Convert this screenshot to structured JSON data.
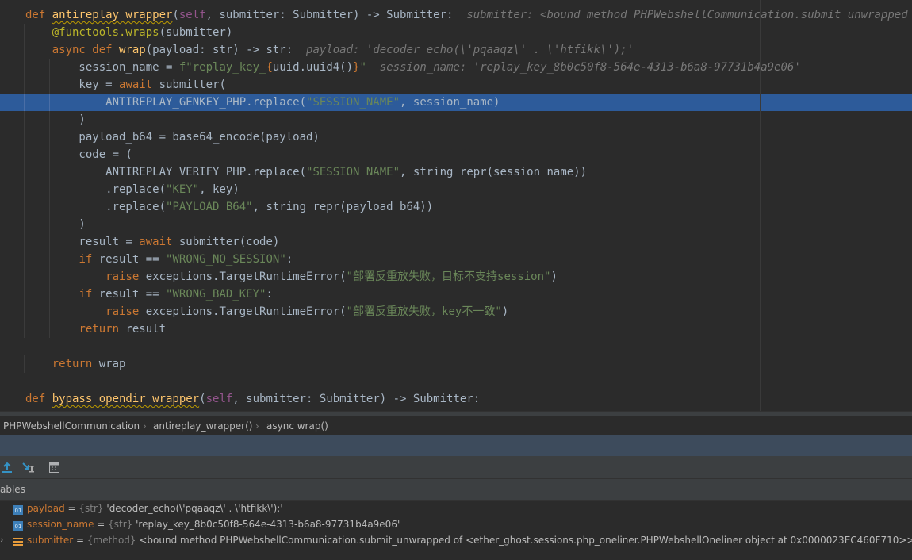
{
  "editor": {
    "lines": [
      {
        "t": [
          [
            "def ",
            "kw"
          ],
          [
            "antireplay_wrapper",
            "fn squig"
          ],
          [
            "(",
            ""
          ],
          [
            "self",
            "self"
          ],
          [
            ", submitter: Submitter) -> Submitter:",
            ""
          ],
          [
            "  submitter: <bound method PHPWebshellCommunication.submit_unwrapped of <eth",
            "hint"
          ]
        ]
      },
      {
        "t": [
          [
            "    ",
            ""
          ],
          [
            "@functools.wraps",
            "dec"
          ],
          [
            "(submitter)",
            ""
          ]
        ]
      },
      {
        "t": [
          [
            "    ",
            ""
          ],
          [
            "async def ",
            "kw"
          ],
          [
            "wrap",
            "fn"
          ],
          [
            "(payload: str) -> str:",
            ""
          ],
          [
            "  payload: 'decoder_echo(\\'pqaaqz\\' . \\'htfikk\\');'",
            "hint"
          ]
        ]
      },
      {
        "t": [
          [
            "        session_name = ",
            ""
          ],
          [
            "f\"replay_key_",
            "str"
          ],
          [
            "{",
            "brace"
          ],
          [
            "uuid.uuid4()",
            ""
          ],
          [
            "}",
            "brace"
          ],
          [
            "\"",
            "str"
          ],
          [
            "  session_name: 'replay_key_8b0c50f8-564e-4313-b6a8-97731b4a9e06'",
            "hint"
          ]
        ]
      },
      {
        "t": [
          [
            "        key = ",
            ""
          ],
          [
            "await ",
            "kw"
          ],
          [
            "submitter(",
            ""
          ]
        ]
      },
      {
        "t": [
          [
            "            ANTIREPLAY_GENKEY_PHP.replace(",
            ""
          ],
          [
            "\"SESSION_NAME\"",
            "str"
          ],
          [
            ", session_name)",
            ""
          ]
        ],
        "hl": true
      },
      {
        "t": [
          [
            "        )",
            ""
          ]
        ]
      },
      {
        "t": [
          [
            "        payload_b64 = base64_encode(payload)",
            ""
          ]
        ]
      },
      {
        "t": [
          [
            "        code = (",
            ""
          ]
        ]
      },
      {
        "t": [
          [
            "            ANTIREPLAY_VERIFY_PHP.replace(",
            ""
          ],
          [
            "\"SESSION_NAME\"",
            "str"
          ],
          [
            ", string_repr(session_name))",
            ""
          ]
        ]
      },
      {
        "t": [
          [
            "            .replace(",
            ""
          ],
          [
            "\"KEY\"",
            "str"
          ],
          [
            ", key)",
            ""
          ]
        ]
      },
      {
        "t": [
          [
            "            .replace(",
            ""
          ],
          [
            "\"PAYLOAD_B64\"",
            "str"
          ],
          [
            ", string_repr(payload_b64))",
            ""
          ]
        ]
      },
      {
        "t": [
          [
            "        )",
            ""
          ]
        ]
      },
      {
        "t": [
          [
            "        result = ",
            ""
          ],
          [
            "await ",
            "kw"
          ],
          [
            "submitter(code)",
            ""
          ]
        ]
      },
      {
        "t": [
          [
            "        ",
            ""
          ],
          [
            "if ",
            "kw"
          ],
          [
            "result == ",
            ""
          ],
          [
            "\"WRONG_NO_SESSION\"",
            "str"
          ],
          [
            ":",
            ""
          ]
        ]
      },
      {
        "t": [
          [
            "            ",
            ""
          ],
          [
            "raise ",
            "kw"
          ],
          [
            "exceptions.TargetRuntimeError(",
            ""
          ],
          [
            "\"部署反重放失败，目标不支持session\"",
            "str"
          ],
          [
            ")",
            ""
          ]
        ]
      },
      {
        "t": [
          [
            "        ",
            ""
          ],
          [
            "if ",
            "kw"
          ],
          [
            "result == ",
            ""
          ],
          [
            "\"WRONG_BAD_KEY\"",
            "str"
          ],
          [
            ":",
            ""
          ]
        ]
      },
      {
        "t": [
          [
            "            ",
            ""
          ],
          [
            "raise ",
            "kw"
          ],
          [
            "exceptions.TargetRuntimeError(",
            ""
          ],
          [
            "\"部署反重放失败，key不一致\"",
            "str"
          ],
          [
            ")",
            ""
          ]
        ]
      },
      {
        "t": [
          [
            "        ",
            ""
          ],
          [
            "return ",
            "kw"
          ],
          [
            "result",
            ""
          ]
        ]
      },
      {
        "t": []
      },
      {
        "t": [
          [
            "    ",
            ""
          ],
          [
            "return ",
            "kw"
          ],
          [
            "wrap",
            ""
          ]
        ]
      },
      {
        "t": []
      },
      {
        "t": [
          [
            "def ",
            "kw"
          ],
          [
            "bypass_opendir_wrapper",
            "fn squig"
          ],
          [
            "(",
            ""
          ],
          [
            "self",
            "self"
          ],
          [
            ", submitter: Submitter) -> Submitter:",
            ""
          ]
        ]
      }
    ]
  },
  "breadcrumb": [
    "PHPWebshellCommunication",
    "antireplay_wrapper()",
    "async wrap()"
  ],
  "breadcrumb_sep": "›",
  "variables_panel": {
    "label": "ables",
    "vars": [
      {
        "name": "payload",
        "type": "{str}",
        "value": "'decoder_echo(\\'pqaaqz\\' . \\'htfikk\\');'",
        "icon": "string-var-icon"
      },
      {
        "name": "session_name",
        "type": "{str}",
        "value": "'replay_key_8b0c50f8-564e-4313-b6a8-97731b4a9e06'",
        "icon": "string-var-icon"
      },
      {
        "name": "submitter",
        "type": "{method}",
        "value": "<bound method PHPWebshellCommunication.submit_unwrapped of <ether_ghost.sessions.php_oneliner.PHPWebshellOneliner object at 0x0000023EC460F710>>",
        "icon": "method-var-icon",
        "expandable": true
      }
    ]
  },
  "toolbar": {
    "icons": [
      "step-out-icon",
      "run-to-cursor-icon",
      "evaluate-expression-icon"
    ]
  },
  "colors": {
    "editor_bg": "#2b2b2b",
    "highlight_line": "#2d5b9a",
    "keyword": "#cc7832",
    "function": "#ffc66d",
    "string": "#6a8759",
    "hint": "#787878"
  }
}
